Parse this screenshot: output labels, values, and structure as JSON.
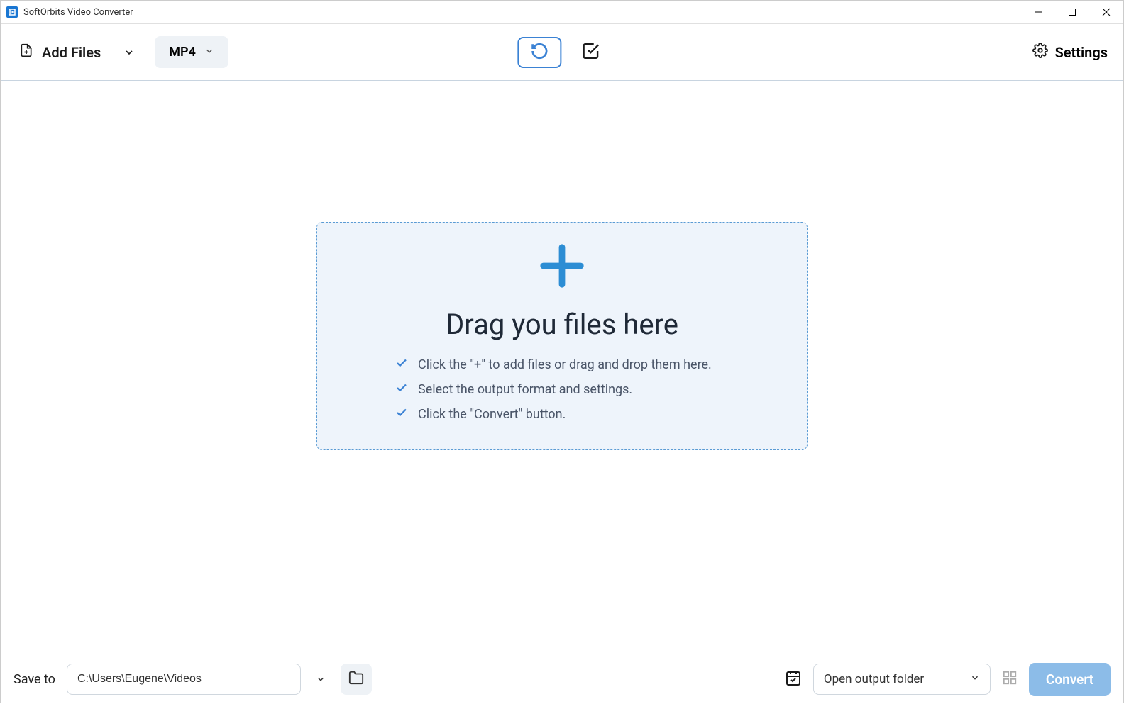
{
  "window": {
    "title": "SoftOrbits Video Converter"
  },
  "toolbar": {
    "add_files_label": "Add Files",
    "format_label": "MP4",
    "settings_label": "Settings"
  },
  "drop_zone": {
    "title": "Drag you files here",
    "steps": [
      "Click the \"+\" to add files or drag and drop them here.",
      "Select the output format and settings.",
      "Click the \"Convert\" button."
    ]
  },
  "bottom": {
    "save_to_label": "Save to",
    "path_value": "C:\\Users\\Eugene\\Videos",
    "open_output_label": "Open output folder",
    "convert_label": "Convert"
  }
}
